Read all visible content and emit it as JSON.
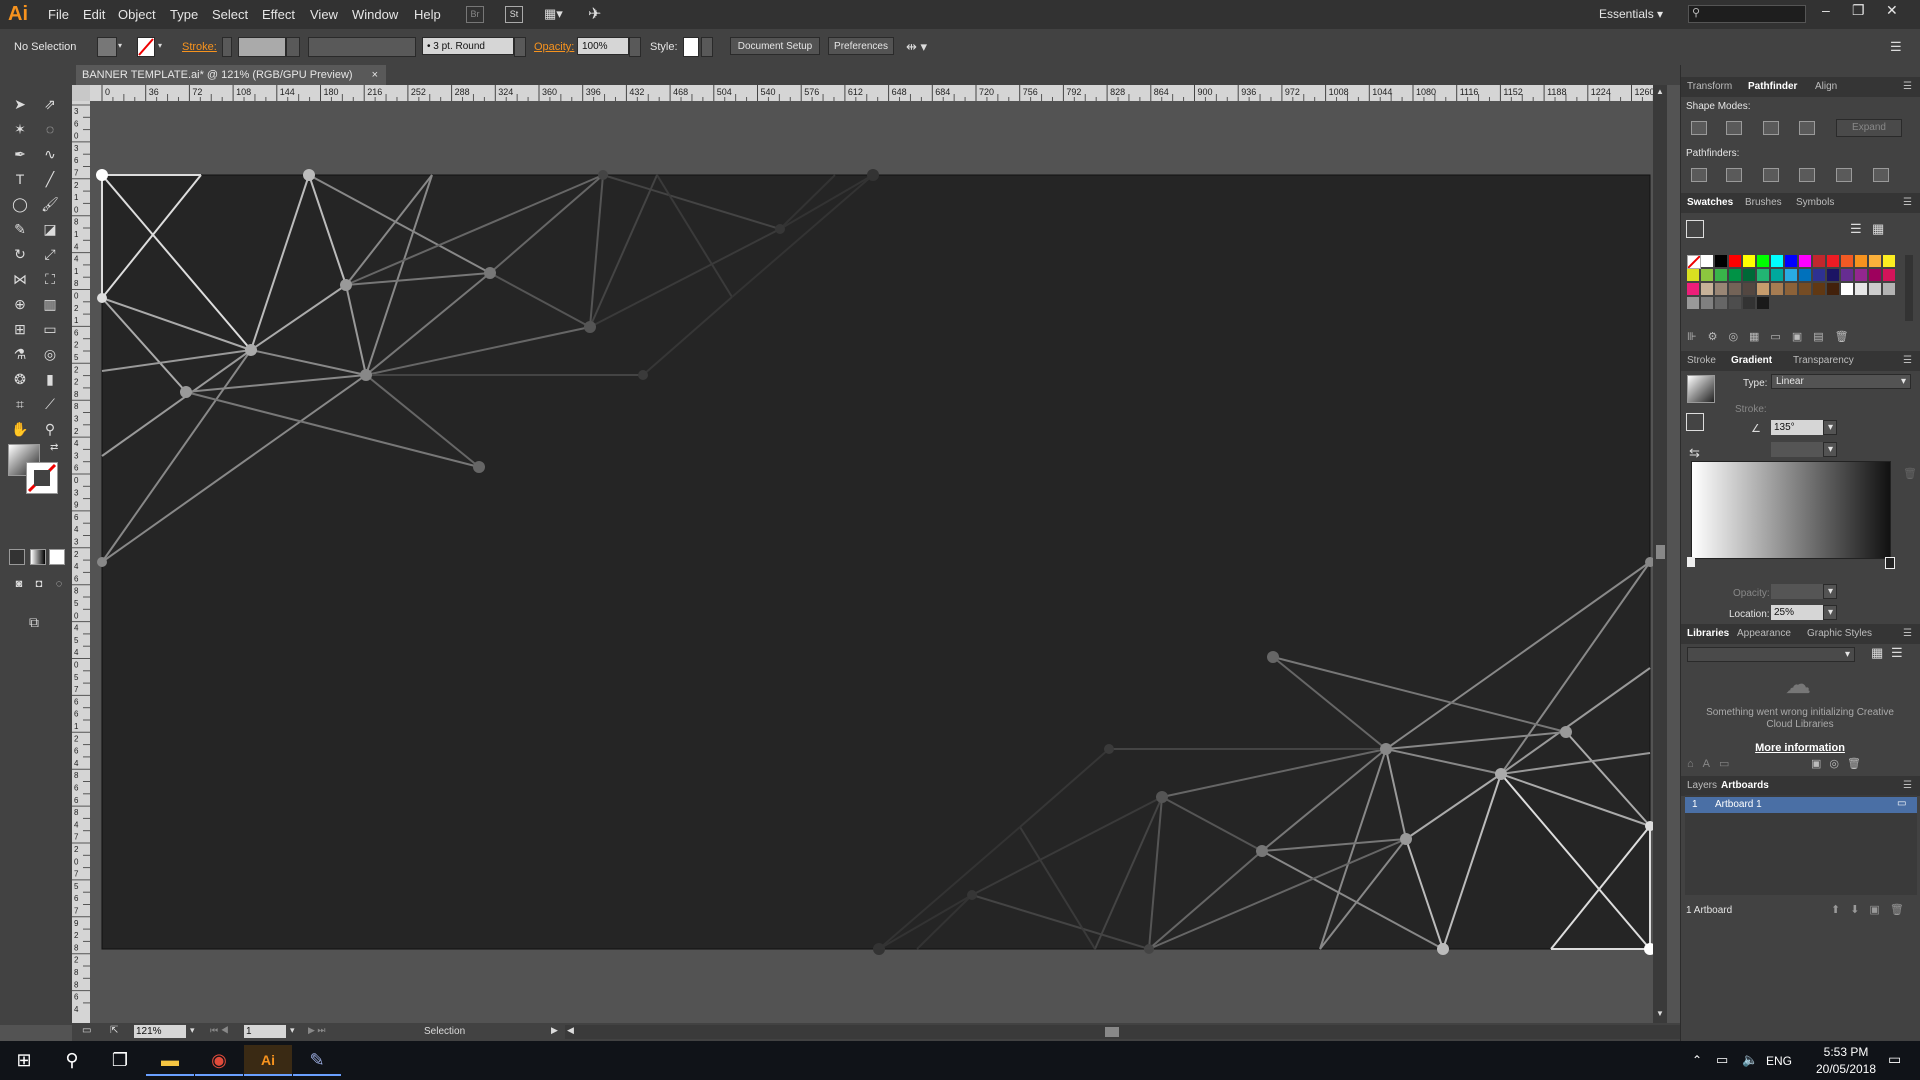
{
  "app": {
    "logo": "Ai"
  },
  "menus": [
    "File",
    "Edit",
    "Object",
    "Type",
    "Select",
    "Effect",
    "View",
    "Window",
    "Help"
  ],
  "workspace": {
    "label": "Essentials"
  },
  "control_bar": {
    "selection": "No Selection",
    "stroke_label": "Stroke:",
    "brush": "3 pt. Round",
    "opacity_label": "Opacity:",
    "opacity_value": "100%",
    "style_label": "Style:",
    "document_setup": "Document Setup",
    "preferences": "Preferences"
  },
  "document": {
    "tab_title": "BANNER TEMPLATE.ai* @ 121% (RGB/GPU Preview)",
    "ruler_ticks_h": [
      "0",
      "36",
      "72",
      "108",
      "144",
      "180",
      "216",
      "252",
      "288",
      "324",
      "360",
      "396",
      "432",
      "468",
      "504",
      "540",
      "576",
      "612",
      "648",
      "684",
      "720",
      "756",
      "792",
      "828",
      "864",
      "900",
      "936",
      "972",
      "1008",
      "1044",
      "1080",
      "1116",
      "1152",
      "1188",
      "1224",
      "1260"
    ],
    "ruler_ticks_v": [
      "3",
      "6",
      "0",
      "3",
      "6",
      "7",
      "2",
      "1",
      "0",
      "8",
      "1",
      "4",
      "4",
      "1",
      "8",
      "0",
      "2",
      "1",
      "6",
      "2",
      "5",
      "2",
      "2",
      "8",
      "8",
      "3",
      "2",
      "4",
      "3",
      "6",
      "0",
      "3",
      "9",
      "6",
      "4",
      "3",
      "2",
      "4",
      "6",
      "8",
      "5",
      "0",
      "4",
      "5",
      "4",
      "0",
      "5",
      "7",
      "6",
      "6",
      "1",
      "2",
      "6",
      "4",
      "8",
      "6",
      "6",
      "8",
      "4",
      "7",
      "2",
      "0",
      "7",
      "5",
      "6",
      "7",
      "9",
      "2",
      "8",
      "2",
      "8",
      "8",
      "6",
      "4"
    ],
    "zoom": "121%",
    "artboard_nav": "1",
    "status_mode": "Selection"
  },
  "panels": {
    "top_tabs": [
      "Transform",
      "Pathfinder",
      "Align"
    ],
    "shape_modes_label": "Shape Modes:",
    "expand_label": "Expand",
    "pathfinders_label": "Pathfinders:",
    "swatch_tabs": [
      "Swatches",
      "Brushes",
      "Symbols"
    ],
    "swatch_colors": [
      "#ffffff",
      "#000000",
      "#ff0000",
      "#ffff00",
      "#00ff00",
      "#00ffff",
      "#0000ff",
      "#ff00ff",
      "#c1272d",
      "#ed1c24",
      "#f15a24",
      "#f7931e",
      "#fbb03b",
      "#fcee21",
      "#d9e021",
      "#8cc63f",
      "#39b54a",
      "#009245",
      "#006837",
      "#22b573",
      "#00a99d",
      "#29abe2",
      "#0071bc",
      "#2e3192",
      "#1b1464",
      "#662d91",
      "#93278f",
      "#9e005d",
      "#d4145a",
      "#ed1e79",
      "#c7b299",
      "#998675",
      "#736357",
      "#534741",
      "#c69c6d",
      "#a67c52",
      "#8c6239",
      "#754c24",
      "#603813",
      "#42210b",
      "#ffffff",
      "#e6e6e6",
      "#cccccc",
      "#b3b3b3",
      "#999999",
      "#808080",
      "#666666",
      "#4d4d4d",
      "#333333",
      "#1a1a1a"
    ],
    "stroke_tabs": [
      "Stroke",
      "Gradient",
      "Transparency"
    ],
    "gradient": {
      "type_label": "Type:",
      "type_value": "Linear",
      "stroke_label": "Stroke:",
      "angle_value": "135°",
      "opacity_label": "Opacity:",
      "location_label": "Location:",
      "location_value": "25%"
    },
    "library_tabs": [
      "Libraries",
      "Appearance",
      "Graphic Styles"
    ],
    "library_error": "Something went wrong initializing Creative Cloud Libraries",
    "more_info": "More information",
    "layer_tabs": [
      "Layers",
      "Artboards"
    ],
    "artboard_index": "1",
    "artboard_name": "Artboard 1",
    "artboard_count": "1 Artboard"
  },
  "taskbar": {
    "lang": "ENG",
    "time": "5:53 PM",
    "date": "20/05/2018"
  },
  "colors": {
    "accent": "#f7931e",
    "artboard": "#252525",
    "selection_blue": "#4a6fa5"
  }
}
